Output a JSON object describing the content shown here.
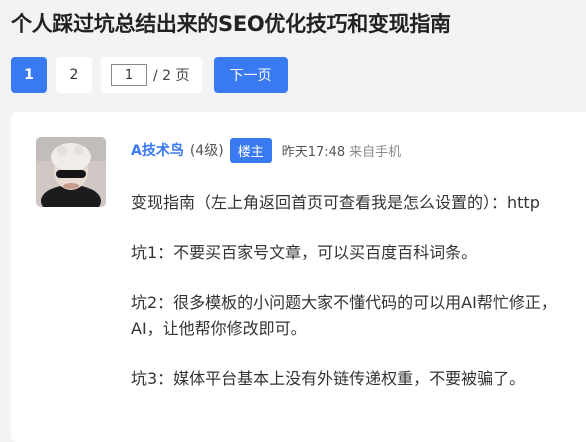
{
  "page": {
    "title": "个人踩过坑总结出来的SEO优化技巧和变现指南"
  },
  "pagination": {
    "pages": [
      "1",
      "2"
    ],
    "current": "1",
    "jump_value": "1",
    "total_label": "/ 2 页",
    "next_label": "下一页"
  },
  "post": {
    "author": "A技术鸟",
    "level": "(4级)",
    "badge": "楼主",
    "time": "昨天17:48",
    "source": "来自手机",
    "paragraphs": [
      "变现指南（左上角返回首页可查看我是怎么设置的）：http",
      "坑1：不要买百家号文章，可以买百度百科词条。",
      "坑2：很多模板的小问题大家不懂代码的可以用AI帮忙修正，",
      "AI，让他帮你修改即可。",
      "坑3：媒体平台基本上没有外链传递权重，不要被骗了。"
    ]
  },
  "colors": {
    "accent": "#3a7af1",
    "page_bg": "#f2f3f5",
    "card_bg": "#ffffff"
  }
}
